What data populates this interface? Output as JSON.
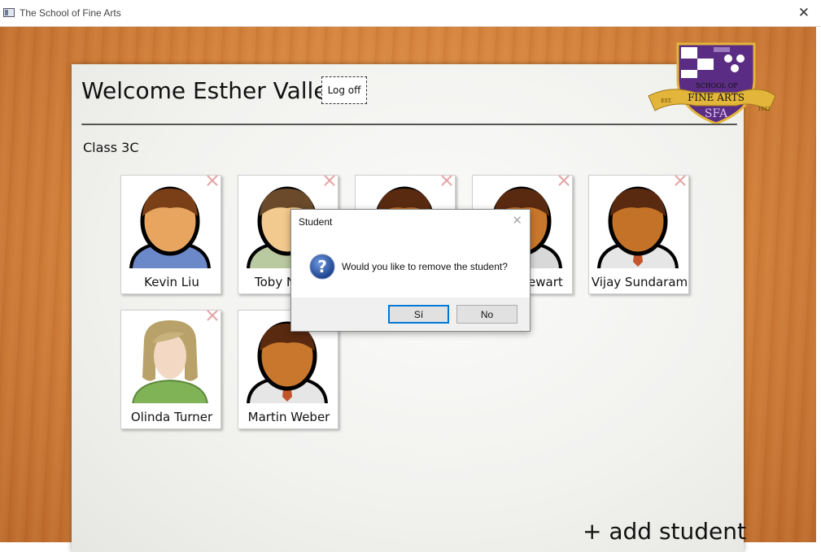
{
  "window": {
    "title": "The School of Fine Arts",
    "close_glyph": "✕"
  },
  "header": {
    "welcome": "Welcome Esther Valle!",
    "logoff_label": "Log off"
  },
  "class_label": "Class 3C",
  "students": [
    {
      "name": "Kevin Liu",
      "avatar": "boy-avatar-blue-sweater"
    },
    {
      "name": "Toby N",
      "avatar": "boy-avatar-green-shirt"
    },
    {
      "name": "",
      "avatar": "boy-avatar"
    },
    {
      "name": "ewart",
      "avatar": "boy-avatar"
    },
    {
      "name": "Vijay Sundaram",
      "avatar": "man-avatar-tie"
    },
    {
      "name": "Olinda Turner",
      "avatar": "woman-avatar"
    },
    {
      "name": "Martin Weber",
      "avatar": "man-avatar-tie"
    }
  ],
  "add_student_label": "+ add student",
  "crest": {
    "top_text": "SCHOOL OF",
    "banner_text": "FINE ARTS",
    "initials": "SFA",
    "left_text": "EST.",
    "right_text": "1942"
  },
  "dialog": {
    "title": "Student",
    "close_glyph": "✕",
    "message": "Would you like to remove the student?",
    "yes_label": "Sí",
    "no_label": "No"
  },
  "colors": {
    "accent": "#0078d7",
    "wood": "#d2803a",
    "crest_purple": "#5b2c83",
    "crest_gold": "#e3b53a"
  }
}
